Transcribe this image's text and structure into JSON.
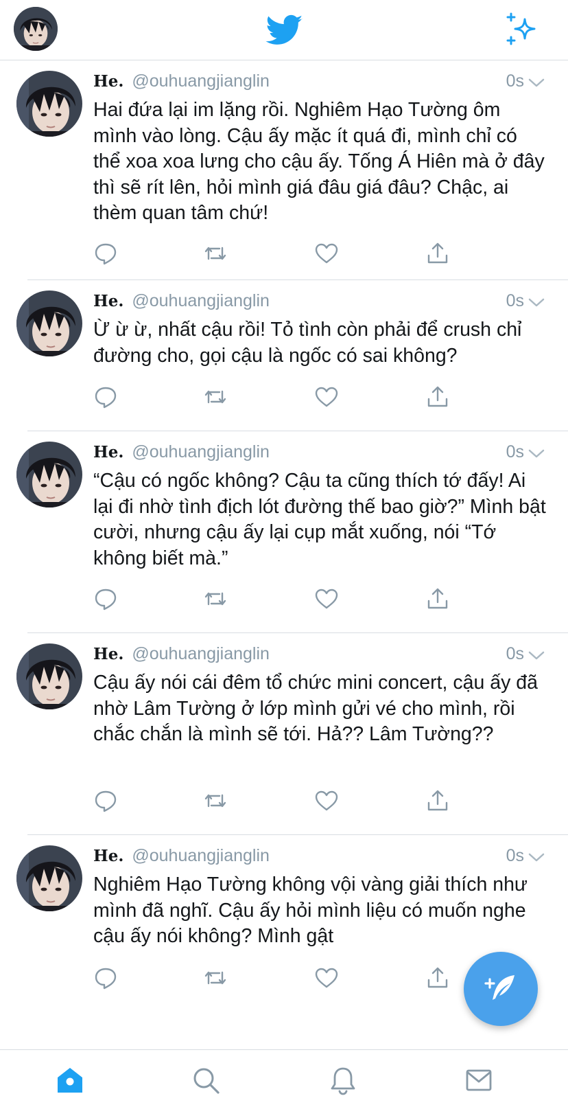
{
  "app": {
    "name": "Twitter",
    "accent": "#1da1f2",
    "fab_color": "#4aa1eb"
  },
  "topbar": {
    "avatar": "avatar",
    "logo_icon": "bird-icon",
    "sparkle_icon": "sparkle-icon"
  },
  "tweets": [
    {
      "name": "He.",
      "handle": "@ouhuangjianglin",
      "time": "0s",
      "text": "Hai đứa lại im lặng rồi. Nghiêm Hạo Tường ôm mình vào lòng. Cậu ấy mặc ít quá đi, mình chỉ có thể xoa xoa lưng cho cậu ấy. Tống Á Hiên mà ở đây thì sẽ rít lên, hỏi mình giá đâu giá đâu? Chậc, ai thèm quan tâm chứ!"
    },
    {
      "name": "He.",
      "handle": "@ouhuangjianglin",
      "time": "0s",
      "text": "Ừ ừ ừ, nhất cậu rồi! Tỏ tình còn phải để crush chỉ đường cho, gọi cậu là ngốc có sai không?"
    },
    {
      "name": "He.",
      "handle": "@ouhuangjianglin",
      "time": "0s",
      "text": "“Cậu có ngốc không? Cậu ta cũng thích tớ đấy! Ai lại đi nhờ tình địch lót đường thế bao giờ?” Mình bật cười, nhưng cậu ấy lại cụp mắt xuống, nói “Tớ không biết mà.”"
    },
    {
      "name": "He.",
      "handle": "@ouhuangjianglin",
      "time": "0s",
      "text": "Cậu ấy nói cái đêm tổ chức mini concert, cậu ấy đã nhờ Lâm Tường ở lớp mình gửi vé cho mình, rồi chắc chắn là mình sẽ tới. Hả?? Lâm Tường??"
    },
    {
      "name": "He.",
      "handle": "@ouhuangjianglin",
      "time": "0s",
      "text": "Nghiêm Hạo Tường không vội vàng giải thích như mình đã nghĩ. Cậu ấy hỏi mình liệu có muốn nghe cậu ấy nói không? Mình gật"
    }
  ],
  "tabbar": {
    "items": [
      {
        "icon": "home-icon",
        "active": true
      },
      {
        "icon": "search-icon",
        "active": false
      },
      {
        "icon": "bell-icon",
        "active": false
      },
      {
        "icon": "mail-icon",
        "active": false
      }
    ]
  },
  "fab": {
    "icon": "compose-icon"
  }
}
